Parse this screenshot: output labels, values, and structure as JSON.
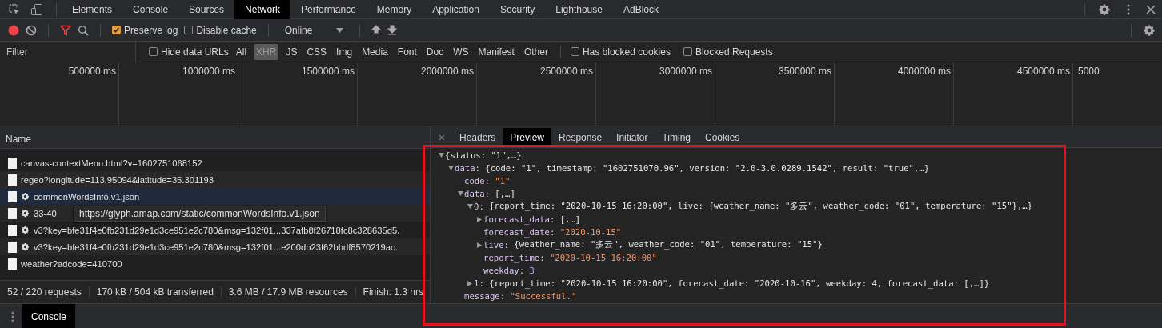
{
  "tabs": [
    {
      "label": "Elements",
      "selected": false
    },
    {
      "label": "Console",
      "selected": false
    },
    {
      "label": "Sources",
      "selected": false
    },
    {
      "label": "Network",
      "selected": true
    },
    {
      "label": "Performance",
      "selected": false
    },
    {
      "label": "Memory",
      "selected": false
    },
    {
      "label": "Application",
      "selected": false
    },
    {
      "label": "Security",
      "selected": false
    },
    {
      "label": "Lighthouse",
      "selected": false
    },
    {
      "label": "AdBlock",
      "selected": false
    }
  ],
  "toolbar": {
    "recording": true,
    "filter_active": true,
    "preserve_log": {
      "label": "Preserve log",
      "checked": true
    },
    "disable_cache": {
      "label": "Disable cache",
      "checked": false
    },
    "throttling": "Online"
  },
  "filter_bar": {
    "placeholder": "Filter",
    "hide_data_urls": {
      "label": "Hide data URLs",
      "checked": false
    },
    "types": [
      {
        "label": "All",
        "selected": false
      },
      {
        "label": "XHR",
        "selected": true
      },
      {
        "label": "JS",
        "selected": false
      },
      {
        "label": "CSS",
        "selected": false
      },
      {
        "label": "Img",
        "selected": false
      },
      {
        "label": "Media",
        "selected": false
      },
      {
        "label": "Font",
        "selected": false
      },
      {
        "label": "Doc",
        "selected": false
      },
      {
        "label": "WS",
        "selected": false
      },
      {
        "label": "Manifest",
        "selected": false
      },
      {
        "label": "Other",
        "selected": false
      }
    ],
    "has_blocked_cookies": {
      "label": "Has blocked cookies",
      "checked": false
    },
    "blocked_requests": {
      "label": "Blocked Requests",
      "checked": false
    }
  },
  "overview": {
    "ticks": [
      "500000 ms",
      "1000000 ms",
      "1500000 ms",
      "2000000 ms",
      "2500000 ms",
      "3000000 ms",
      "3500000 ms",
      "4000000 ms",
      "4500000 ms",
      "5000"
    ]
  },
  "requests": {
    "header": "Name",
    "rows": [
      {
        "name": "canvas-contextMenu.html?v=1602751068152",
        "gear": false,
        "selected": false
      },
      {
        "name": "regeo?longitude=113.95094&latitude=35.301193",
        "gear": false,
        "selected": false
      },
      {
        "name": "commonWordsInfo.v1.json",
        "gear": true,
        "selected": true
      },
      {
        "name": "33-40",
        "gear": true,
        "selected": false
      },
      {
        "name": "v3?key=bfe31f4e0fb231d29e1d3ce951e2c780&msg=132f01...337afb8f26718fc8c328635d5.",
        "gear": true,
        "selected": false
      },
      {
        "name": "v3?key=bfe31f4e0fb231d29e1d3ce951e2c780&msg=132f01...e200db23f62bbdf8570219ac.",
        "gear": true,
        "selected": false
      },
      {
        "name": "weather?adcode=410700",
        "gear": false,
        "selected": false
      }
    ],
    "tooltip": "https://glyph.amap.com/static/commonWordsInfo.v1.json"
  },
  "status_bar": [
    "52 / 220 requests",
    "170 kB / 504 kB transferred",
    "3.6 MB / 17.9 MB resources",
    "Finish: 1.3 hrs"
  ],
  "detail": {
    "tabs": [
      {
        "label": "Headers",
        "selected": false
      },
      {
        "label": "Preview",
        "selected": true
      },
      {
        "label": "Response",
        "selected": false
      },
      {
        "label": "Initiator",
        "selected": false
      },
      {
        "label": "Timing",
        "selected": false
      },
      {
        "label": "Cookies",
        "selected": false
      }
    ],
    "tree": [
      {
        "kind": "object",
        "text": "{status: \"1\",…}",
        "expanded": true,
        "children": [
          {
            "kind": "object",
            "key": "data:",
            "text": "{code: \"1\", timestamp: \"1602751070.96\", version: \"2.0-3.0.0289.1542\", result: \"true\",…}",
            "expanded": true,
            "children": [
              {
                "kind": "string",
                "key": "code:",
                "text": "\"1\""
              },
              {
                "kind": "object",
                "key": "data:",
                "text": "[,…]",
                "expanded": true,
                "children": [
                  {
                    "kind": "object",
                    "key": "0:",
                    "text": "{report_time: \"2020-10-15 16:20:00\", live: {weather_name: \"多云\", weather_code: \"01\", temperature: \"15\"},…}",
                    "expanded": true,
                    "children": [
                      {
                        "kind": "object",
                        "key": "forecast_data:",
                        "text": "[,…]",
                        "expanded": false
                      },
                      {
                        "kind": "string",
                        "key": "forecast_date:",
                        "text": "\"2020-10-15\""
                      },
                      {
                        "kind": "object",
                        "key": "live:",
                        "text": "{weather_name: \"多云\", weather_code: \"01\", temperature: \"15\"}",
                        "expanded": false
                      },
                      {
                        "kind": "string",
                        "key": "report_time:",
                        "text": "\"2020-10-15 16:20:00\""
                      },
                      {
                        "kind": "number",
                        "key": "weekday:",
                        "text": "3"
                      }
                    ]
                  },
                  {
                    "kind": "object",
                    "key": "1:",
                    "text": "{report_time: \"2020-10-15 16:20:00\", forecast_date: \"2020-10-16\", weekday: 4, forecast_data: [,…]}",
                    "expanded": false
                  }
                ]
              },
              {
                "kind": "string",
                "key": "message:",
                "text": "\"Successful.\""
              }
            ]
          }
        ]
      }
    ]
  },
  "drawer": {
    "tabs": [
      {
        "label": "Console",
        "selected": true
      }
    ]
  }
}
